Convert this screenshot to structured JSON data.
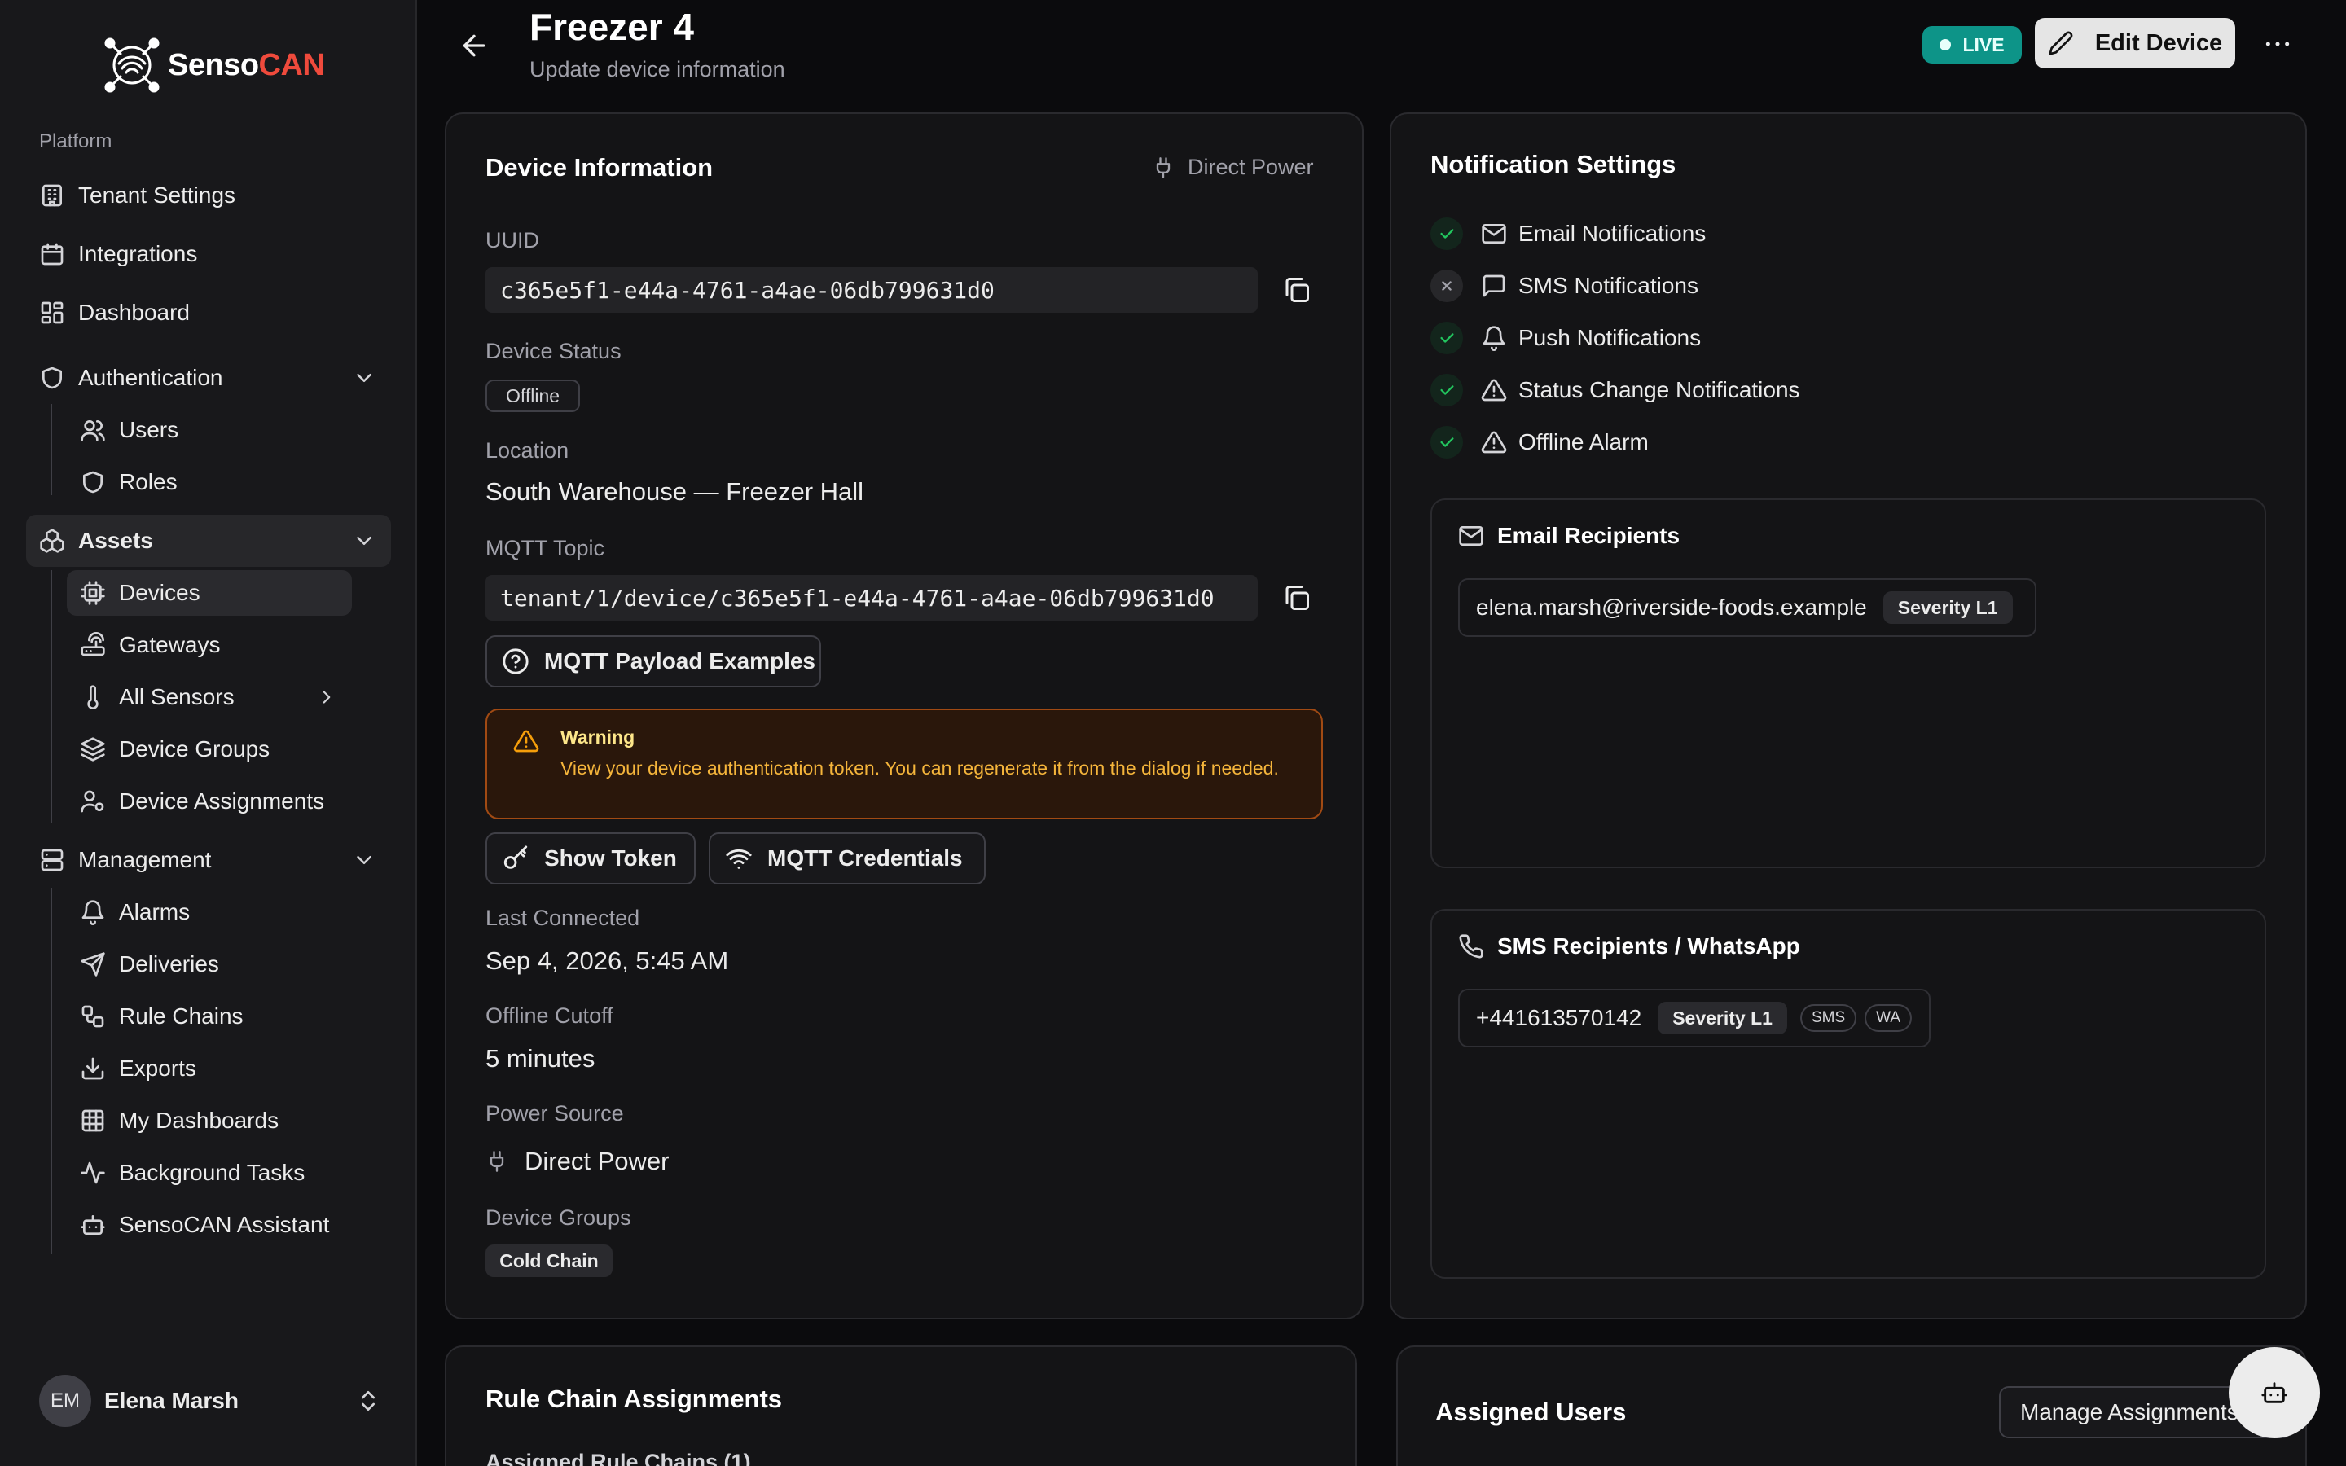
{
  "brand": {
    "name_part1": "Senso",
    "name_part2": "CAN"
  },
  "sidebar": {
    "section_label": "Platform",
    "items": [
      {
        "label": "Tenant Settings",
        "icon": "building-icon"
      },
      {
        "label": "Integrations",
        "icon": "calendar-icon"
      },
      {
        "label": "Dashboard",
        "icon": "layout-dashboard-icon"
      },
      {
        "label": "Authentication",
        "icon": "shield-icon"
      },
      {
        "label": "Users",
        "icon": "users-icon"
      },
      {
        "label": "Roles",
        "icon": "shield-icon"
      },
      {
        "label": "Assets",
        "icon": "boxes-icon"
      },
      {
        "label": "Devices",
        "icon": "cpu-icon"
      },
      {
        "label": "Gateways",
        "icon": "router-icon"
      },
      {
        "label": "All Sensors",
        "icon": "thermometer-icon"
      },
      {
        "label": "Device Groups",
        "icon": "layers-icon"
      },
      {
        "label": "Device Assignments",
        "icon": "user-cog-icon"
      },
      {
        "label": "Management",
        "icon": "server-icon"
      },
      {
        "label": "Alarms",
        "icon": "bell-icon"
      },
      {
        "label": "Deliveries",
        "icon": "send-icon"
      },
      {
        "label": "Rule Chains",
        "icon": "workflow-icon"
      },
      {
        "label": "Exports",
        "icon": "download-icon"
      },
      {
        "label": "My Dashboards",
        "icon": "grid-icon"
      },
      {
        "label": "Background Tasks",
        "icon": "activity-icon"
      },
      {
        "label": "SensoCAN Assistant",
        "icon": "bot-icon"
      }
    ],
    "user": {
      "initials": "EM",
      "name": "Elena Marsh"
    }
  },
  "header": {
    "title": "Freezer 4",
    "subtitle": "Update device information",
    "live_label": "LIVE",
    "edit_label": "Edit Device"
  },
  "device_info": {
    "title": "Device Information",
    "power_badge": "Direct Power",
    "uuid_label": "UUID",
    "uuid": "c365e5f1-e44a-4761-a4ae-06db799631d0",
    "status_label": "Device Status",
    "status": "Offline",
    "location_label": "Location",
    "location": "South Warehouse — Freezer Hall",
    "mqtt_label": "MQTT Topic",
    "mqtt_topic": "tenant/1/device/c365e5f1-e44a-4761-a4ae-06db799631d0",
    "payload_btn": "MQTT Payload Examples",
    "warning_title": "Warning",
    "warning_text": "View your device authentication token. You can regenerate it from the dialog if needed.",
    "show_token_btn": "Show Token",
    "mqtt_credentials_btn": "MQTT Credentials",
    "last_connected_label": "Last Connected",
    "last_connected": "Sep 4, 2026, 5:45 AM",
    "offline_cutoff_label": "Offline Cutoff",
    "offline_cutoff": "5 minutes",
    "power_source_label": "Power Source",
    "power_source": "Direct Power",
    "groups_label": "Device Groups",
    "group": "Cold Chain"
  },
  "notifications": {
    "title": "Notification Settings",
    "items": [
      {
        "label": "Email Notifications",
        "enabled": true,
        "icon": "mail-icon"
      },
      {
        "label": "SMS Notifications",
        "enabled": false,
        "icon": "message-square-icon"
      },
      {
        "label": "Push Notifications",
        "enabled": true,
        "icon": "bell-icon"
      },
      {
        "label": "Status Change Notifications",
        "enabled": true,
        "icon": "alert-triangle-icon"
      },
      {
        "label": "Offline Alarm",
        "enabled": true,
        "icon": "alert-triangle-icon"
      }
    ],
    "email_recipients_title": "Email Recipients",
    "email_recipient": {
      "address": "elena.marsh@riverside-foods.example",
      "severity": "Severity L1"
    },
    "sms_recipients_title": "SMS Recipients / WhatsApp",
    "sms_recipient": {
      "phone": "+441613570142",
      "severity": "Severity L1",
      "tag_sms": "SMS",
      "tag_wa": "WA"
    }
  },
  "rule_chains": {
    "title": "Rule Chain Assignments",
    "subtitle": "Assigned Rule Chains (1)"
  },
  "assigned_users": {
    "title": "Assigned Users",
    "manage_btn": "Manage Assignments"
  },
  "colors": {
    "accent_live": "#0d9488",
    "brand_red": "#ef4a3c",
    "warning_border": "#a14a13",
    "success": "#22c55e"
  }
}
